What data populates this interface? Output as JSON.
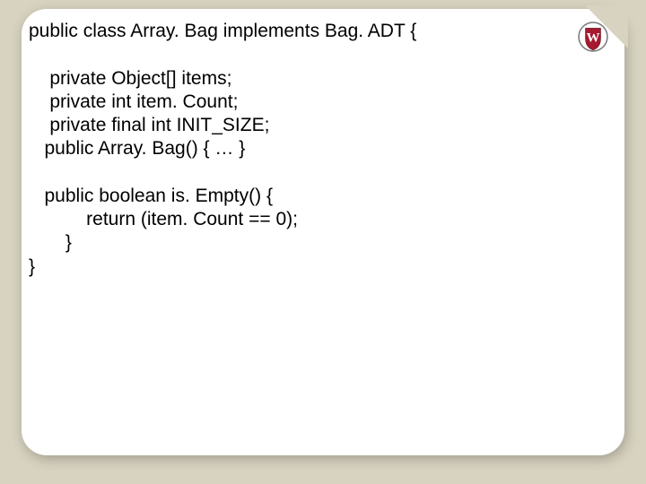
{
  "code": {
    "l1": "public class Array. Bag implements Bag. ADT {",
    "l2": "    private Object[] items;",
    "l3": "    private int item. Count;",
    "l4": "    private final int INIT_SIZE;",
    "l5": "   public Array. Bag() { … }",
    "l6": "   public boolean is. Empty() {",
    "l7": "           return (item. Count == 0);",
    "l8": "       }",
    "l9": "}"
  },
  "crest": {
    "letter": "W",
    "bg": "#a6192e",
    "ring": "#7a7a7a",
    "fg": "#ffffff"
  }
}
